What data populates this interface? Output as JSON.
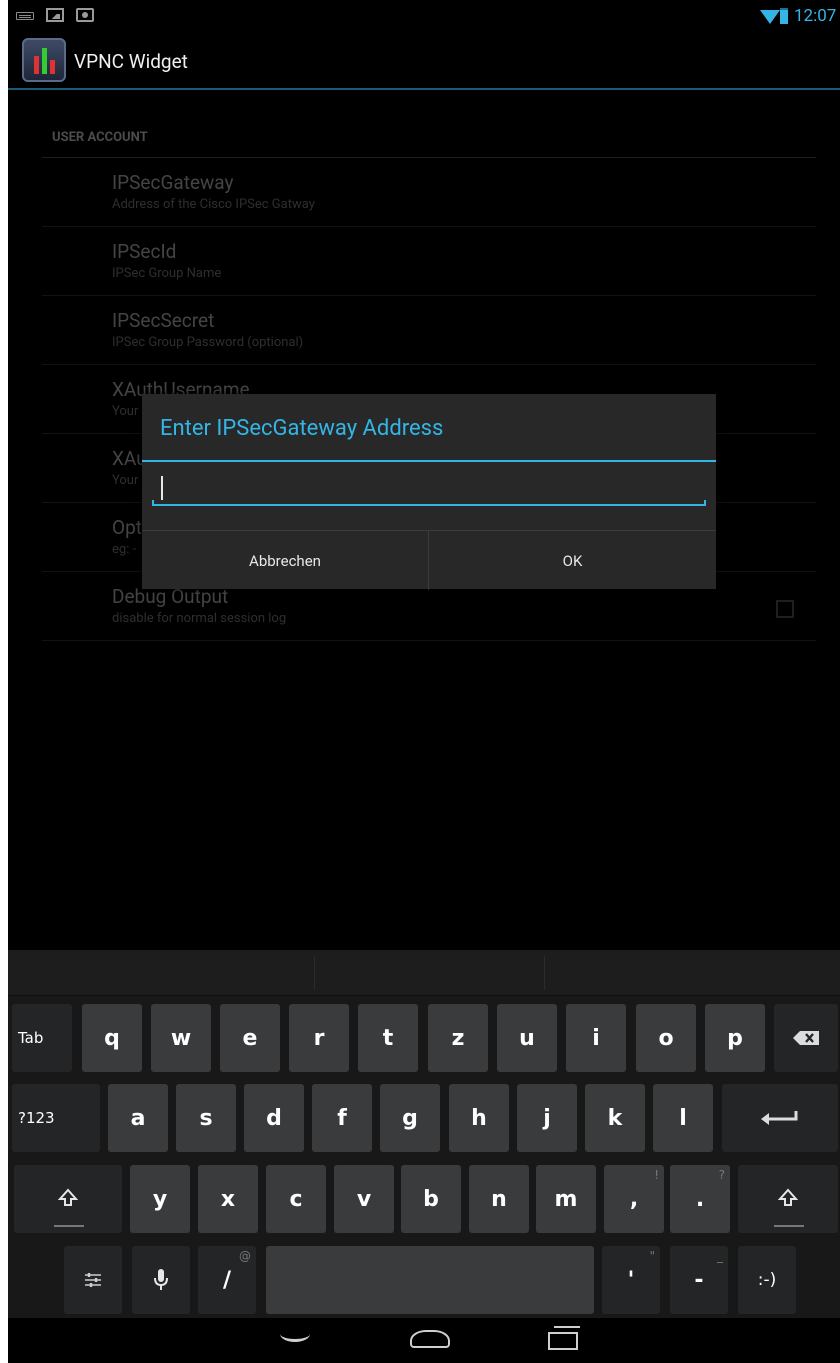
{
  "status_bar": {
    "time": "12:07",
    "icons": [
      "keyboard-icon",
      "picture-icon",
      "camera-icon",
      "wifi-icon",
      "battery-icon"
    ]
  },
  "action_bar": {
    "title": "VPNC Widget"
  },
  "preferences": {
    "section_header": "USER ACCOUNT",
    "items": [
      {
        "title": "IPSecGateway",
        "summary": "Address of the Cisco IPSec Gatway"
      },
      {
        "title": "IPSecId",
        "summary": "IPSec Group Name"
      },
      {
        "title": "IPSecSecret",
        "summary": "IPSec Group Password (optional)"
      },
      {
        "title": "XAuthUsername",
        "summary": "Your"
      },
      {
        "title": "XAu",
        "summary": "Your"
      },
      {
        "title": "Opt",
        "summary": "eg: -"
      },
      {
        "title": "Debug Output",
        "summary": "disable for normal session log"
      }
    ]
  },
  "dialog": {
    "title": "Enter IPSecGateway Address",
    "input_value": "",
    "cancel_label": "Abbrechen",
    "ok_label": "OK"
  },
  "keyboard": {
    "row1": [
      "Tab",
      "q",
      "w",
      "e",
      "r",
      "t",
      "z",
      "u",
      "i",
      "o",
      "p"
    ],
    "row2": [
      "?123",
      "a",
      "s",
      "d",
      "f",
      "g",
      "h",
      "j",
      "k",
      "l"
    ],
    "row3": [
      "y",
      "x",
      "c",
      "v",
      "b",
      "n",
      "m",
      ",",
      "."
    ],
    "row3_subs": {
      "comma": "!",
      "period": "?"
    },
    "row4": {
      "slash": "/",
      "slash_sub": "@",
      "apostrophe": "'",
      "apostrophe_sub": "\"",
      "dash": "-",
      "dash_sub": "_",
      "smiley": ":-)"
    }
  },
  "colors": {
    "accent": "#33b5e5",
    "dialog_bg": "#282828",
    "key_bg": "#3a3b3d"
  }
}
